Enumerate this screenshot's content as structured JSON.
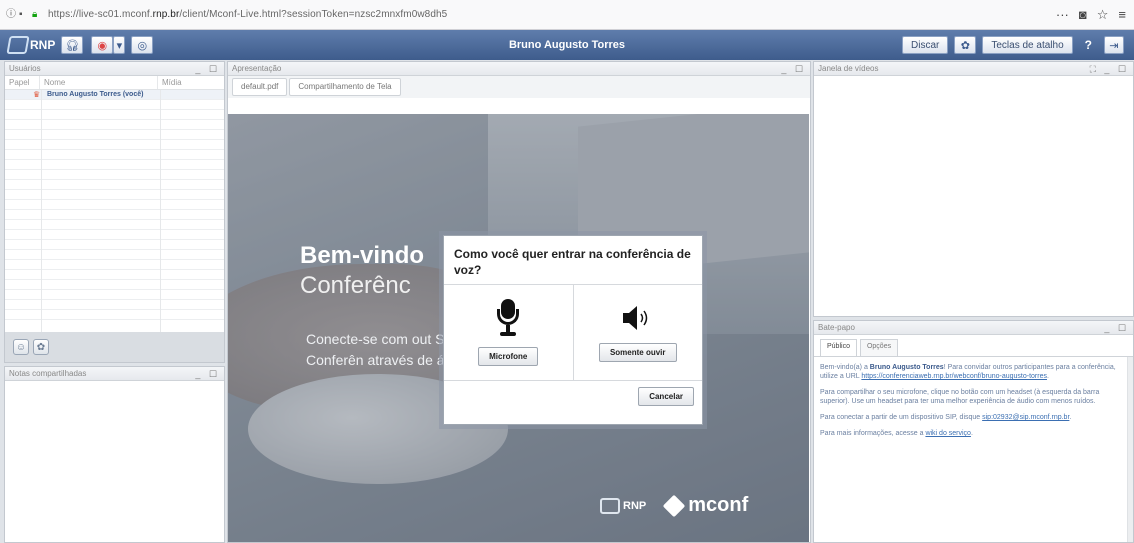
{
  "browser": {
    "url_prefix": "https://live-sc01.mconf.",
    "url_domain": "rnp.br",
    "url_suffix": "/client/Mconf-Live.html?sessionToken=nzsc2mnxfm0w8dh5",
    "menu_icons": "··· ",
    "bookmark": "☆",
    "hamburger": "≡"
  },
  "appbar": {
    "logo": "RNP",
    "title": "Bruno Augusto Torres",
    "dial_label": "Discar",
    "shortcuts_label": "Teclas de atalho",
    "help_label": "?"
  },
  "users": {
    "title": "Usuários",
    "col_role": "Papel",
    "col_name": "Nome",
    "col_media": "Mídia",
    "user_name": "Bruno Augusto Torres (você)"
  },
  "notes": {
    "title": "Notas compartilhadas"
  },
  "presentation": {
    "title": "Apresentação",
    "tabs": [
      "default.pdf",
      "Compartilhamento de Tela"
    ],
    "slide_title": "Bem-vindo",
    "slide_sub": "Conferênc",
    "slide_text": "Conecte-se com out Serviço de Conferên através de áudio, víd",
    "slide_logo_rnp": "RNP",
    "slide_logo_mconf": "mconf"
  },
  "video": {
    "title": "Janela de vídeos"
  },
  "chat": {
    "title": "Bate-papo",
    "tabs": [
      "Público",
      "Opções"
    ],
    "msg1_a": "Bem-vindo(a) a ",
    "msg1_name": "Bruno Augusto Torres",
    "msg1_b": "! Para convidar outros participantes para a conferência, utilize a URL ",
    "msg1_link": "https://conferenciaweb.rnp.br/webconf/bruno-augusto-torres",
    "msg1_end": ".",
    "msg2": "Para compartilhar o seu microfone, clique no botão com um headset (à esquerda da barra superior). Use um headset para ter uma melhor experiência de áudio com menos ruídos.",
    "msg3_a": "Para conectar a partir de um dispositivo SIP, disque ",
    "msg3_link": "sip:02932@sip.mconf.rnp.br",
    "msg3_end": ".",
    "msg4_a": "Para mais informações, acesse a ",
    "msg4_link": "wiki do serviço",
    "msg4_end": "."
  },
  "dialog": {
    "question": "Como você quer entrar na conferência de voz?",
    "microphone_label": "Microfone",
    "listen_label": "Somente ouvir",
    "cancel_label": "Cancelar"
  }
}
